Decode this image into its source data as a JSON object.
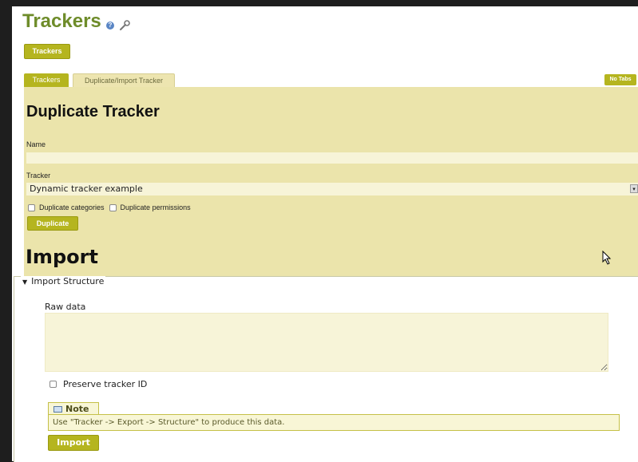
{
  "header": {
    "title": "Trackers",
    "help_icon": "help-icon",
    "edit_icon": "wrench-icon"
  },
  "toolbar": {
    "trackers_button": "Trackers"
  },
  "tabs": [
    {
      "label": "Trackers",
      "active": false
    },
    {
      "label": "Duplicate/Import Tracker",
      "active": true
    }
  ],
  "no_tabs_label": "No Tabs",
  "duplicate": {
    "heading": "Duplicate Tracker",
    "name_label": "Name",
    "name_value": "",
    "tracker_label": "Tracker",
    "tracker_selected": "Dynamic tracker example",
    "dup_categories_label": "Duplicate categories",
    "dup_permissions_label": "Duplicate permissions",
    "button_label": "Duplicate"
  },
  "import": {
    "heading": "Import",
    "legend": "Import Structure",
    "raw_label": "Raw data",
    "raw_value": "",
    "preserve_label": "Preserve tracker ID",
    "note_title": "Note",
    "note_text": "Use \"Tracker -> Export -> Structure\" to produce this data.",
    "button_label": "Import"
  },
  "colors": {
    "accent": "#b5b51f",
    "panel": "#ebe4ab",
    "title": "#6e8c2a"
  }
}
